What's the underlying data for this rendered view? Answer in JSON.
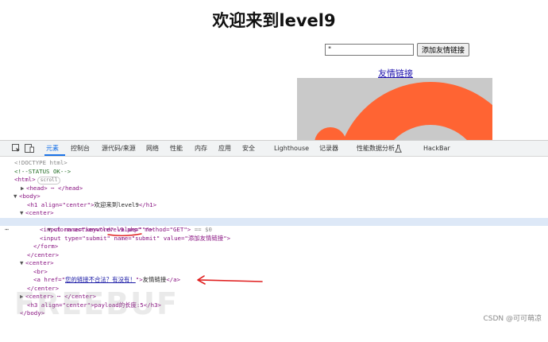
{
  "preview": {
    "title": "欢迎来到level9",
    "input_value": "\"",
    "submit_label": "添加友情链接",
    "link_text": "友情链接"
  },
  "devtools": {
    "tabs": [
      "元素",
      "控制台",
      "源代码/来源",
      "网络",
      "性能",
      "内存",
      "应用",
      "安全",
      "Lighthouse",
      "记录器",
      "性能数据分析",
      "HackBar"
    ],
    "active_tab": "元素",
    "lines": {
      "doctype": "<!DOCTYPE html>",
      "comment": "<!--STATUS OK-->",
      "html_open": "<html>",
      "html_pill": "scroll",
      "head": "<head> ⋯ </head>",
      "body_open": "<body>",
      "h1": {
        "open": "<h1 align=\"center\">",
        "text": "欢迎来到level9",
        "close": "</h1>"
      },
      "center_open": "<center>",
      "form": {
        "open": "<form action=\"level9.php\" method=\"GET\">",
        "suffix": " == $0"
      },
      "input_keyword": "<input name=\"keyword\" value=\"\"\">",
      "input_submit": "<input type=\"submit\" name=\"submit\" value=\"添加友情链接\">",
      "form_close": "</form>",
      "center_close": "</center>",
      "center2_open": "<center>",
      "br": "<br>",
      "a": {
        "open_prefix": "<a href=\"",
        "href": "您的链接不合法？有没有！",
        "open_suffix": "\">",
        "text": "友情链接",
        "close": "</a>"
      },
      "center2_close": "</center>",
      "center3": "<center> ⋯ </center>",
      "h3": "<h3 align=\"center\">payload的长度:5</h3>",
      "body_close": "</body>"
    }
  },
  "watermark": "CSDN @可可萌凉",
  "freebuf": "FREEBUF",
  "colors": {
    "accent": "#1a73e8",
    "annotation": "#e02020",
    "image_orange": "#ff6433"
  }
}
